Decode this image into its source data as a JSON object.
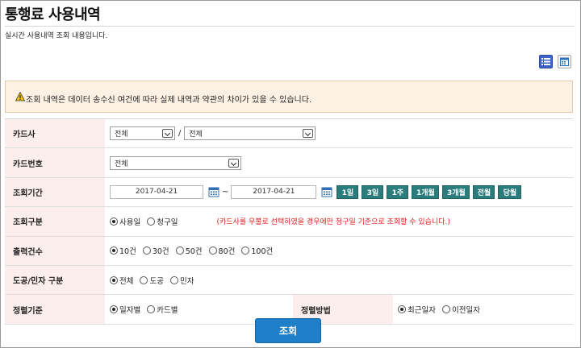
{
  "page": {
    "title": "통행료 사용내역",
    "subtitle": "실시간 사용내역 조회 내용입니다."
  },
  "notice": {
    "text": "조회 내역은 데이터 송수신 여건에 따라 실제 내역과 약관의 차이가 있을 수 있습니다."
  },
  "form": {
    "card_company": {
      "label": "카드사",
      "select1": "전체",
      "separator": "/",
      "select2": "전체"
    },
    "card_number": {
      "label": "카드번호",
      "select": "전체"
    },
    "period": {
      "label": "조회기간",
      "start": "2017-04-21",
      "tilde": "~",
      "end": "2017-04-21",
      "buttons": [
        "1일",
        "3일",
        "1주",
        "1개월",
        "3개월",
        "전월",
        "당월"
      ]
    },
    "lookup_type": {
      "label": "조회구분",
      "options": [
        "사용일",
        "청구일"
      ],
      "selected": 0,
      "note": "(카드사를 우불로 선택하였을 경우에만 청구일 기준으로 조회할 수 있습니다.)"
    },
    "output_count": {
      "label": "출력건수",
      "options": [
        "10건",
        "30건",
        "50건",
        "80건",
        "100건"
      ],
      "selected": 0
    },
    "road_type": {
      "label": "도공/민자 구분",
      "options": [
        "전체",
        "도공",
        "민자"
      ],
      "selected": 0
    },
    "sort_basis": {
      "label": "정렬기준",
      "options": [
        "일자별",
        "카드별"
      ],
      "selected": 0
    },
    "sort_method": {
      "label": "정렬방법",
      "options": [
        "최근일자",
        "이전일자"
      ],
      "selected": 0
    }
  },
  "submit_label": "조회",
  "colors": {
    "label_bg": "#fdeeee",
    "period_button": "#2b7d7d",
    "submit_button": "#1f7fc8",
    "notice_bg": "#fdf1e4",
    "note_red": "#e02020"
  }
}
